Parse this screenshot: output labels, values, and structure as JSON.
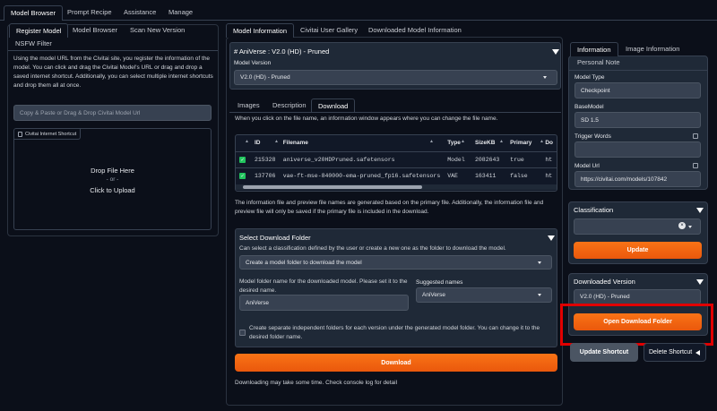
{
  "top_tabs": [
    "Model Browser",
    "Prompt Recipe",
    "Assistance",
    "Manage"
  ],
  "left": {
    "tabs": [
      "Register Model",
      "Model Browser",
      "Scan New Version",
      "NSFW Filter"
    ],
    "description": "Using the model URL from the Civitai site, you register the information of the model. You can click and drag the Civitai Model's URL or drag and drop a saved internet shortcut. Additionally, you can select multiple internet shortcuts and drop them all at once.",
    "url_placeholder": "Copy & Paste or Drag & Drop Civitai Model Url",
    "shortcut_label": "Civitai Internet Shortcut",
    "drop_text": [
      "Drop File Here",
      "- or -",
      "Click to Upload"
    ]
  },
  "center": {
    "tabs": [
      "Model Information",
      "Civitai User Gallery",
      "Downloaded Model Information"
    ],
    "model_title": "# AniVerse : V2.0 (HD) - Pruned",
    "model_version_label": "Model Version",
    "model_version_value": "V2.0 (HD) - Pruned",
    "sub_tabs": [
      "Images",
      "Description",
      "Download"
    ],
    "file_hint": "When you click on the file name, an information window appears where you can change the file name.",
    "table": {
      "headers": [
        "ID",
        "Filename",
        "Type",
        "SizeKB",
        "Primary",
        "Do"
      ],
      "rows": [
        {
          "id": "215328",
          "filename": "aniverse_v20HDPruned.safetensors",
          "type": "Model",
          "size": "2082643",
          "primary": "true",
          "dl": "ht"
        },
        {
          "id": "137706",
          "filename": "vae-ft-mse-840000-ema-pruned_fp16.safetensors",
          "type": "VAE",
          "size": "163411",
          "primary": "false",
          "dl": "ht"
        }
      ]
    },
    "file_note": "The information file and preview file names are generated based on the primary file. Additionally, the information file and preview file will only be saved if the primary file is included in the download.",
    "download_folder": {
      "title": "Select Download Folder",
      "hint": "Can select a classification defined by the user or create a new one as the folder to download the model.",
      "select_value": "Create a model folder to download the model",
      "folder_label": "Model folder name for the downloaded model. Please set it to the desired name.",
      "folder_value": "AniVerse",
      "suggested_label": "Suggested names",
      "suggested_value": "AniVerse",
      "checkbox_text": "Create separate independent folders for each version under the generated model folder. You can change it to the desired folder name."
    },
    "download_button": "Download",
    "download_note": "Downloading may take some time. Check console log for detail"
  },
  "right": {
    "tabs": [
      "Information",
      "Image Information",
      "Personal Note"
    ],
    "fields": [
      {
        "label": "Model Type",
        "value": "Checkpoint"
      },
      {
        "label": "BaseModel",
        "value": "SD 1.5"
      },
      {
        "label": "Trigger Words",
        "value": ""
      },
      {
        "label": "Model Url",
        "value": "https://civitai.com/models/107842"
      }
    ],
    "classification_title": "Classification",
    "update_button": "Update",
    "downloaded_version_title": "Downloaded Version",
    "downloaded_version_value": "V2.0 (HD) - Pruned",
    "open_folder_button": "Open Download Folder",
    "update_shortcut_button": "Update Shortcut",
    "delete_shortcut_button": "Delete Shortcut",
    "highlight_color": "#e00000"
  }
}
